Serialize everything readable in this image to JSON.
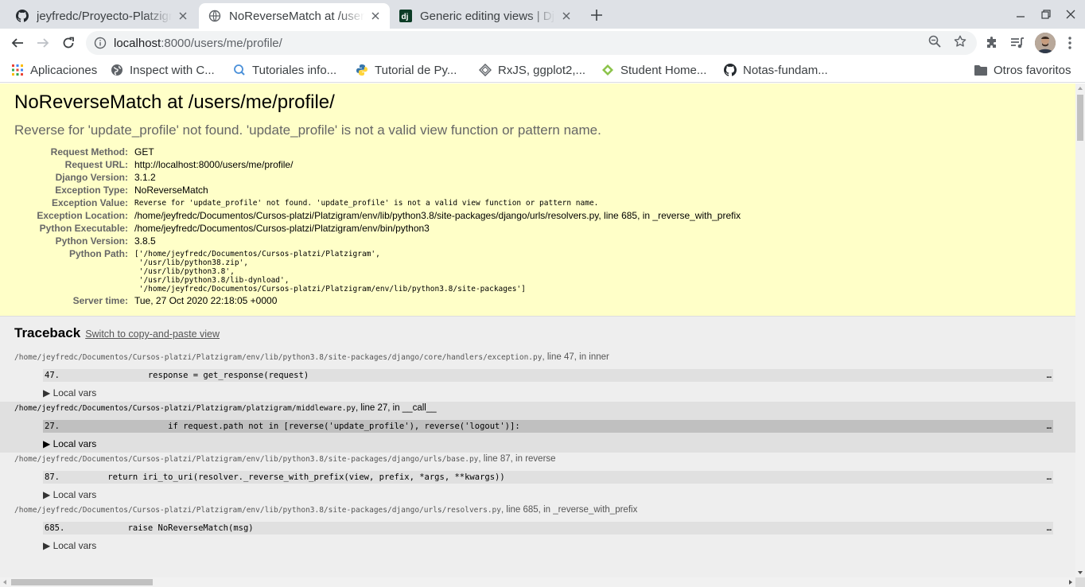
{
  "tabs": [
    {
      "title": "jeyfredc/Proyecto-Platzigram",
      "favicon": "github-icon"
    },
    {
      "title": "NoReverseMatch at /users/me/profile/",
      "favicon": "globe-icon"
    },
    {
      "title": "Generic editing views | Django",
      "favicon": "django-icon"
    }
  ],
  "omnibox": {
    "host": "localhost",
    "rest": ":8000/users/me/profile/"
  },
  "bookmarks": [
    {
      "label": "Aplicaciones",
      "icon": "apps-grid-icon"
    },
    {
      "label": "Inspect with C...",
      "icon": "globe-icon"
    },
    {
      "label": "Tutoriales info...",
      "icon": "search-bubble-icon"
    },
    {
      "label": "Tutorial de Py...",
      "icon": "python-icon"
    },
    {
      "label": "RxJS, ggplot2,...",
      "icon": "diamond-icon"
    },
    {
      "label": "Student Home...",
      "icon": "student-icon"
    },
    {
      "label": "Notas-fundam...",
      "icon": "github-icon"
    }
  ],
  "other_bookmarks": "Otros favoritos",
  "error": {
    "title": "NoReverseMatch at /users/me/profile/",
    "message": "Reverse for 'update_profile' not found. 'update_profile' is not a valid view function or pattern name.",
    "meta": [
      {
        "label": "Request Method:",
        "value": "GET"
      },
      {
        "label": "Request URL:",
        "value": "http://localhost:8000/users/me/profile/"
      },
      {
        "label": "Django Version:",
        "value": "3.1.2"
      },
      {
        "label": "Exception Type:",
        "value": "NoReverseMatch"
      },
      {
        "label": "Exception Value:",
        "value": "Reverse for 'update_profile' not found. 'update_profile' is not a valid view function or pattern name."
      },
      {
        "label": "Exception Location:",
        "value": "/home/jeyfredc/Documentos/Cursos-platzi/Platzigram/env/lib/python3.8/site-packages/django/urls/resolvers.py, line 685, in _reverse_with_prefix"
      },
      {
        "label": "Python Executable:",
        "value": "/home/jeyfredc/Documentos/Cursos-platzi/Platzigram/env/bin/python3"
      },
      {
        "label": "Python Version:",
        "value": "3.8.5"
      },
      {
        "label": "Python Path:",
        "value": "['/home/jeyfredc/Documentos/Cursos-platzi/Platzigram',\n '/usr/lib/python38.zip',\n '/usr/lib/python3.8',\n '/usr/lib/python3.8/lib-dynload',\n '/home/jeyfredc/Documentos/Cursos-platzi/Platzigram/env/lib/python3.8/site-packages']"
      },
      {
        "label": "Server time:",
        "value": "Tue, 27 Oct 2020 22:18:05 +0000"
      }
    ]
  },
  "traceback": {
    "heading": "Traceback",
    "switch_link": "Switch to copy-and-paste view",
    "local_vars_label": "Local vars",
    "frames": [
      {
        "file": "/home/jeyfredc/Documentos/Cursos-platzi/Platzigram/env/lib/python3.8/site-packages/django/core/handlers/exception.py",
        "where": ", line 47, in inner",
        "num": "47.",
        "code": "            response = get_response(request)"
      },
      {
        "file": "/home/jeyfredc/Documentos/Cursos-platzi/Platzigram/platzigram/middleware.py",
        "where": ", line 27, in __call__",
        "num": "27.",
        "code": "                if request.path not in [reverse('update_profile'), reverse('logout')]:"
      },
      {
        "file": "/home/jeyfredc/Documentos/Cursos-platzi/Platzigram/env/lib/python3.8/site-packages/django/urls/base.py",
        "where": ", line 87, in reverse",
        "num": "87.",
        "code": "    return iri_to_uri(resolver._reverse_with_prefix(view, prefix, *args, **kwargs))"
      },
      {
        "file": "/home/jeyfredc/Documentos/Cursos-platzi/Platzigram/env/lib/python3.8/site-packages/django/urls/resolvers.py",
        "where": ", line 685, in _reverse_with_prefix",
        "num": "685.",
        "code": "        raise NoReverseMatch(msg)"
      }
    ],
    "ellipsis": "…"
  }
}
